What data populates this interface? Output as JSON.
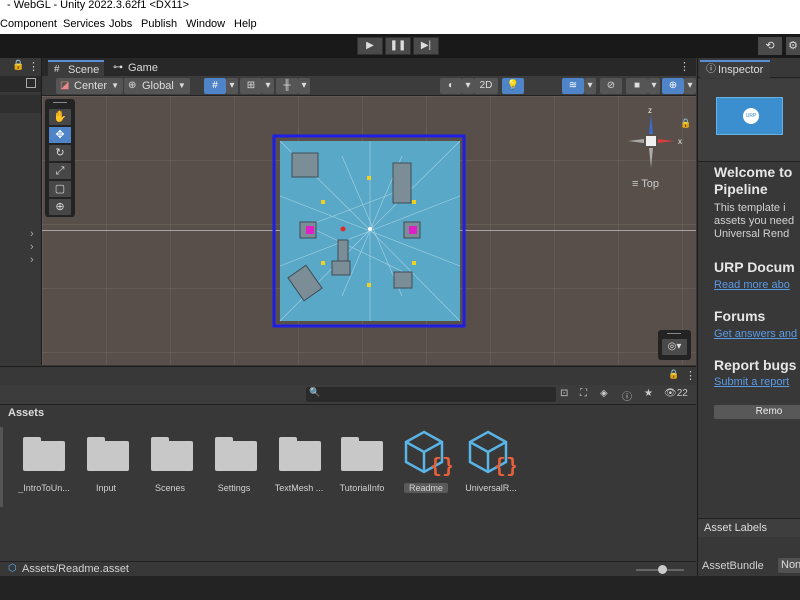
{
  "window": {
    "title": "- WebGL - Unity 2022.3.62f1 <DX11>"
  },
  "menu": [
    "Component",
    "Services",
    "Jobs",
    "Publish",
    "Window",
    "Help"
  ],
  "toolbar": {
    "play": "▶",
    "pause": "❚❚",
    "step": "▶|"
  },
  "scene_tabs": [
    {
      "label": "Scene",
      "active": true
    },
    {
      "label": "Game",
      "active": false
    }
  ],
  "scene_toolbar": {
    "pivot": "Center",
    "space": "Global",
    "mode2d": "2D"
  },
  "gizmo": {
    "axis_z": "z",
    "axis_x": "x",
    "view": "Top"
  },
  "inspector": {
    "tab": "Inspector",
    "badge": "URP",
    "welcome_title_1": "Welcome to",
    "welcome_title_2": "Pipeline",
    "welcome_text_1": "This template i",
    "welcome_text_2": "assets you need",
    "welcome_text_3": "Universal Rend",
    "section1_title": "URP Docum",
    "section1_link": "Read more abo",
    "section2_title": "Forums",
    "section2_link": "Get answers and",
    "section3_title": "Report bugs",
    "section3_link": "Submit a report",
    "remove_button": "Remo",
    "asset_labels": "Asset Labels",
    "asset_bundle_label": "AssetBundle",
    "asset_bundle_value": "Non"
  },
  "project": {
    "header": "Assets",
    "hidden_count": "22",
    "items": [
      {
        "label": "_IntroToUn...",
        "type": "folder"
      },
      {
        "label": "Input",
        "type": "folder"
      },
      {
        "label": "Scenes",
        "type": "folder"
      },
      {
        "label": "Settings",
        "type": "folder"
      },
      {
        "label": "TextMesh ...",
        "type": "folder"
      },
      {
        "label": "TutorialInfo",
        "type": "folder"
      },
      {
        "label": "Readme",
        "type": "asset",
        "selected": true
      },
      {
        "label": "UniversalR...",
        "type": "asset"
      }
    ]
  },
  "status": {
    "path": "Assets/Readme.asset"
  },
  "colors": {
    "accent": "#4f84c8",
    "selection_border": "#1e1ee6",
    "water": "#5aa8c8",
    "link": "#5a9be6"
  }
}
